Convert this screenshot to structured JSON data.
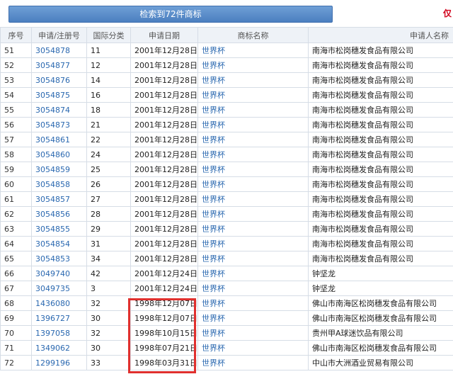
{
  "header": {
    "search_button": "检索到72件商标",
    "side_note": "仅"
  },
  "columns": [
    "序号",
    "申请/注册号",
    "国际分类",
    "申请日期",
    "商标名称",
    "申请人名称"
  ],
  "rows": [
    [
      "51",
      "3054878",
      "11",
      "2001年12月28日",
      "世界杯",
      "南海市松岗穗发食品有限公司"
    ],
    [
      "52",
      "3054877",
      "12",
      "2001年12月28日",
      "世界杯",
      "南海市松岗穗发食品有限公司"
    ],
    [
      "53",
      "3054876",
      "14",
      "2001年12月28日",
      "世界杯",
      "南海市松岗穗发食品有限公司"
    ],
    [
      "54",
      "3054875",
      "16",
      "2001年12月28日",
      "世界杯",
      "南海市松岗穗发食品有限公司"
    ],
    [
      "55",
      "3054874",
      "18",
      "2001年12月28日",
      "世界杯",
      "南海市松岗穗发食品有限公司"
    ],
    [
      "56",
      "3054873",
      "21",
      "2001年12月28日",
      "世界杯",
      "南海市松岗穗发食品有限公司"
    ],
    [
      "57",
      "3054861",
      "22",
      "2001年12月28日",
      "世界杯",
      "南海市松岗穗发食品有限公司"
    ],
    [
      "58",
      "3054860",
      "24",
      "2001年12月28日",
      "世界杯",
      "南海市松岗穗发食品有限公司"
    ],
    [
      "59",
      "3054859",
      "25",
      "2001年12月28日",
      "世界杯",
      "南海市松岗穗发食品有限公司"
    ],
    [
      "60",
      "3054858",
      "26",
      "2001年12月28日",
      "世界杯",
      "南海市松岗穗发食品有限公司"
    ],
    [
      "61",
      "3054857",
      "27",
      "2001年12月28日",
      "世界杯",
      "南海市松岗穗发食品有限公司"
    ],
    [
      "62",
      "3054856",
      "28",
      "2001年12月28日",
      "世界杯",
      "南海市松岗穗发食品有限公司"
    ],
    [
      "63",
      "3054855",
      "29",
      "2001年12月28日",
      "世界杯",
      "南海市松岗穗发食品有限公司"
    ],
    [
      "64",
      "3054854",
      "31",
      "2001年12月28日",
      "世界杯",
      "南海市松岗穗发食品有限公司"
    ],
    [
      "65",
      "3054853",
      "34",
      "2001年12月28日",
      "世界杯",
      "南海市松岗穗发食品有限公司"
    ],
    [
      "66",
      "3049740",
      "42",
      "2001年12月24日",
      "世界杯",
      "钟坚龙"
    ],
    [
      "67",
      "3049735",
      "3",
      "2001年12月24日",
      "世界杯",
      "钟坚龙"
    ],
    [
      "68",
      "1436080",
      "32",
      "1998年12月07日",
      "世界杯",
      "佛山市南海区松岗穗发食品有限公司"
    ],
    [
      "69",
      "1396727",
      "30",
      "1998年12月07日",
      "世界杯",
      "佛山市南海区松岗穗发食品有限公司"
    ],
    [
      "70",
      "1397058",
      "32",
      "1998年10月15日",
      "世界杯",
      "贵州甲A球迷饮品有限公司"
    ],
    [
      "71",
      "1349062",
      "30",
      "1998年07月21日",
      "世界杯",
      "佛山市南海区松岗穗发食品有限公司"
    ],
    [
      "72",
      "1299196",
      "33",
      "1998年03月31日",
      "世界杯",
      "中山市大洲酒业贸易有限公司"
    ]
  ]
}
